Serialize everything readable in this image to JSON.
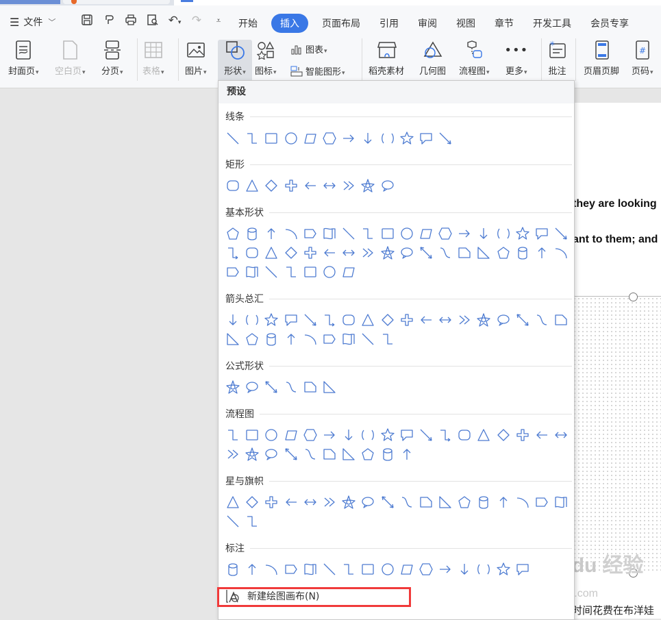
{
  "menubar": {
    "file_label": "文件",
    "tabs": [
      "开始",
      "插入",
      "页面布局",
      "引用",
      "审阅",
      "视图",
      "章节",
      "开发工具",
      "会员专享"
    ],
    "active_tab": "插入"
  },
  "toolbar": {
    "cover": "封面页",
    "blank": "空白页",
    "pagebreak": "分页",
    "table": "表格",
    "picture": "图片",
    "shape": "形状",
    "icon": "图标",
    "chart": "图表",
    "smartart": "智能图形",
    "material": "稻壳素材",
    "geometry": "几何图",
    "flowchart": "流程图",
    "more": "更多",
    "comment": "批注",
    "header_footer": "页眉页脚",
    "page_number": "页码"
  },
  "dropdown": {
    "header": "预设",
    "sections": [
      {
        "title": "线条",
        "count": 12
      },
      {
        "title": "矩形",
        "count": 9
      },
      {
        "title": "基本形状",
        "count": 43
      },
      {
        "title": "箭头总汇",
        "count": 27
      },
      {
        "title": "公式形状",
        "count": 6
      },
      {
        "title": "流程图",
        "count": 28
      },
      {
        "title": "星与旗帜",
        "count": 20
      },
      {
        "title": "标注",
        "count": 16
      }
    ],
    "new_canvas": "新建绘图画布(N)"
  },
  "document": {
    "line1": "they are looking",
    "line2": "ant to them; and",
    "bottom_line": "如何帮孩子知道自己在说什么。他们把时间花费在布洋娃"
  },
  "watermark": {
    "text": "Baidu经验",
    "url": "jingyan.baidu.com"
  },
  "colors": {
    "accent": "#3a78e6",
    "shape_stroke": "#4d7bd1",
    "highlight_box": "#f03a3a"
  }
}
